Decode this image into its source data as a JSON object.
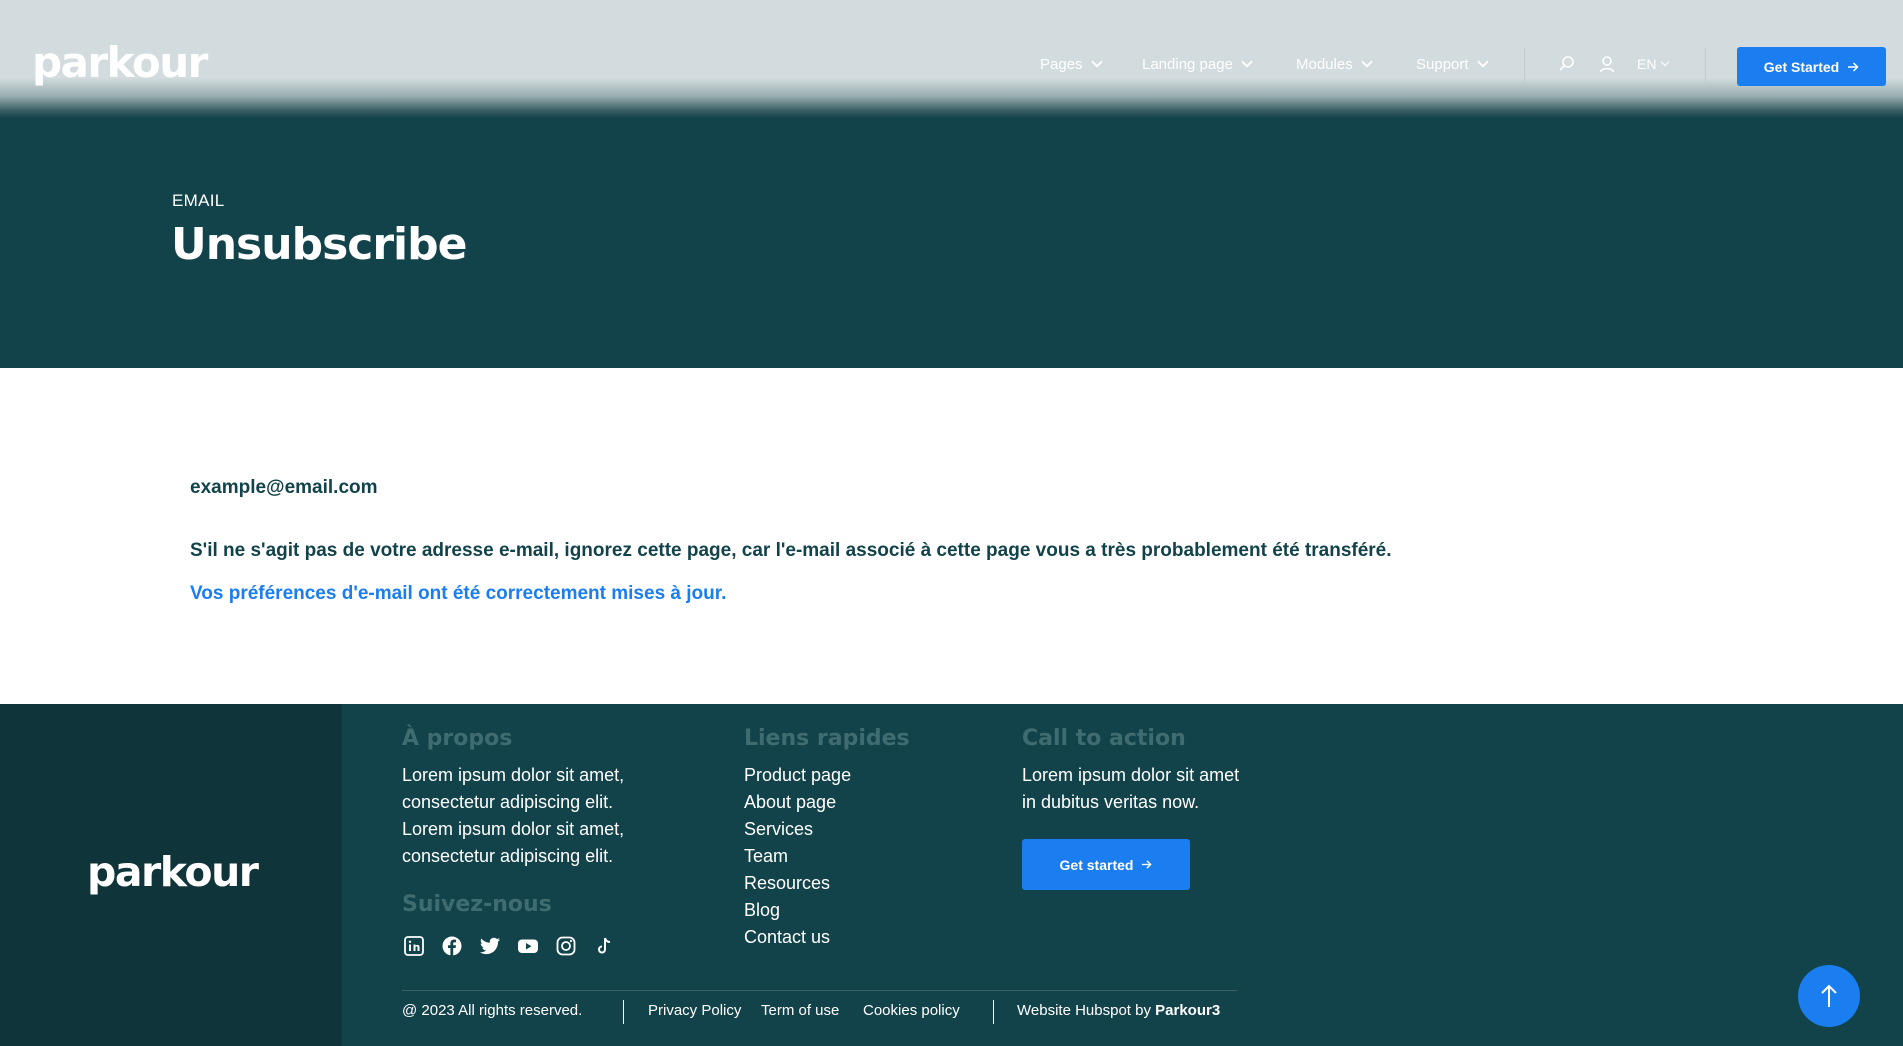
{
  "header": {
    "logo": "parkour",
    "nav": [
      "Pages",
      "Landing page",
      "Modules",
      "Support"
    ],
    "language": "EN",
    "cta_label": "Get Started"
  },
  "hero": {
    "eyebrow": "EMAIL",
    "title": "Unsubscribe"
  },
  "main": {
    "email": "example@email.com",
    "message": "S'il ne s'agit pas de votre adresse e-mail, ignorez cette page, car l'e-mail associé à cette page vous a très probablement été transféré.",
    "success": "Vos préférences d'e-mail ont été correctement mises à jour."
  },
  "footer": {
    "logo": "parkour",
    "about": {
      "heading": "À propos",
      "lines": [
        "Lorem ipsum dolor sit amet,",
        "consectetur adipiscing elit.",
        "Lorem ipsum dolor sit amet,",
        "consectetur adipiscing elit."
      ]
    },
    "follow": {
      "heading": "Suivez-nous",
      "icons": [
        "linkedin-icon",
        "facebook-icon",
        "twitter-icon",
        "youtube-icon",
        "instagram-icon",
        "tiktok-icon"
      ]
    },
    "links": {
      "heading": "Liens rapides",
      "items": [
        "Product page",
        "About page",
        "Services",
        "Team",
        "Resources",
        "Blog",
        "Contact us"
      ]
    },
    "cta": {
      "heading": "Call to action",
      "lines": [
        "Lorem ipsum dolor sit amet",
        "in dubitus veritas now."
      ],
      "button": "Get started"
    },
    "bottom": {
      "copyright": "@ 2023 All rights reserved.",
      "legal": [
        "Privacy Policy",
        "Term of use",
        "Cookies policy"
      ],
      "credit_prefix": "Website Hubspot by ",
      "credit_name": "Parkour3"
    }
  },
  "colors": {
    "brand_dark": "#13434a",
    "footer_left": "#0f3439",
    "accent": "#1a7ef0",
    "header_bg": "#d2dbdd",
    "footer_heading": "#3f6c70"
  }
}
